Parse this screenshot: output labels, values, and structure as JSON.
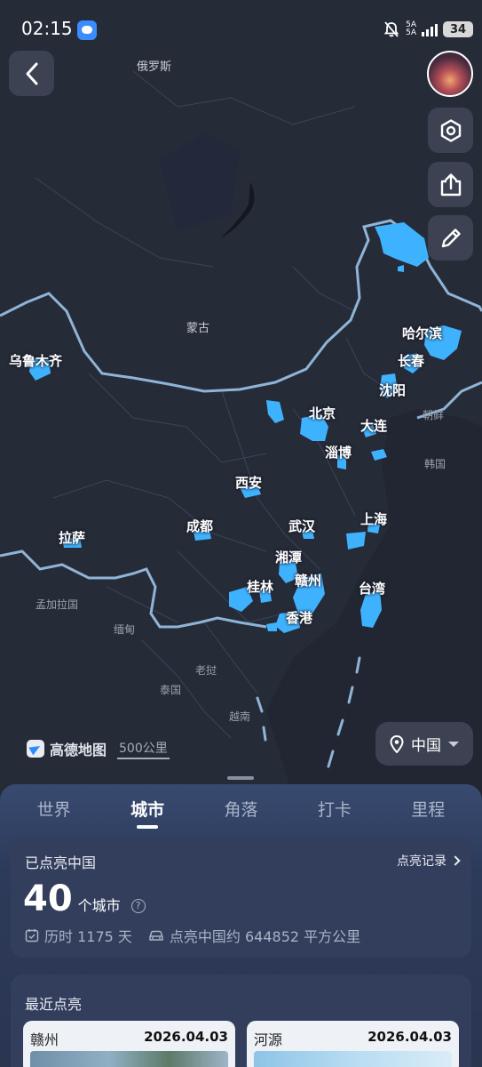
{
  "status_bar": {
    "time": "02:15",
    "network_top": "5A",
    "network_bottom": "5A",
    "battery": "34"
  },
  "map": {
    "countries": [
      {
        "key": "russia",
        "label": "俄罗斯"
      },
      {
        "key": "mongolia",
        "label": "蒙古"
      },
      {
        "key": "north_korea",
        "label": "朝鲜"
      },
      {
        "key": "south_korea",
        "label": "韩国"
      },
      {
        "key": "bangladesh",
        "label": "孟加拉国"
      },
      {
        "key": "myanmar",
        "label": "缅甸"
      },
      {
        "key": "laos",
        "label": "老挝"
      },
      {
        "key": "thailand",
        "label": "泰国"
      },
      {
        "key": "vietnam",
        "label": "越南"
      }
    ],
    "cities": [
      {
        "key": "urumqi",
        "label": "乌鲁木齐"
      },
      {
        "key": "harbin",
        "label": "哈尔滨"
      },
      {
        "key": "changchun",
        "label": "长春"
      },
      {
        "key": "shenyang",
        "label": "沈阳"
      },
      {
        "key": "beijing",
        "label": "北京"
      },
      {
        "key": "dalian",
        "label": "大连"
      },
      {
        "key": "zibo",
        "label": "淄博"
      },
      {
        "key": "xian",
        "label": "西安"
      },
      {
        "key": "chengdu",
        "label": "成都"
      },
      {
        "key": "wuhan",
        "label": "武汉"
      },
      {
        "key": "shanghai",
        "label": "上海"
      },
      {
        "key": "lhasa",
        "label": "拉萨"
      },
      {
        "key": "xiangtan",
        "label": "湘潭"
      },
      {
        "key": "ganzhou",
        "label": "赣州"
      },
      {
        "key": "guilin",
        "label": "桂林"
      },
      {
        "key": "taiwan",
        "label": "台湾"
      },
      {
        "key": "hongkong",
        "label": "香港"
      }
    ],
    "highlight_color": "#3fb2ff",
    "brand": "高德地图",
    "scale": "500公里"
  },
  "controls": {
    "region_selector": "中国"
  },
  "tabs": [
    {
      "label": "世界",
      "active": false
    },
    {
      "label": "城市",
      "active": true
    },
    {
      "label": "角落",
      "active": false
    },
    {
      "label": "打卡",
      "active": false
    },
    {
      "label": "里程",
      "active": false
    }
  ],
  "summary": {
    "title": "已点亮中国",
    "record_link": "点亮记录",
    "count": "40",
    "count_unit": "个城市",
    "duration": "历时 1175 天",
    "area": "点亮中国约 644852 平方公里"
  },
  "recent": {
    "title": "最近点亮",
    "items": [
      {
        "name": "赣州",
        "date": "2026.04.03"
      },
      {
        "name": "河源",
        "date": "2026.04.03"
      }
    ]
  }
}
